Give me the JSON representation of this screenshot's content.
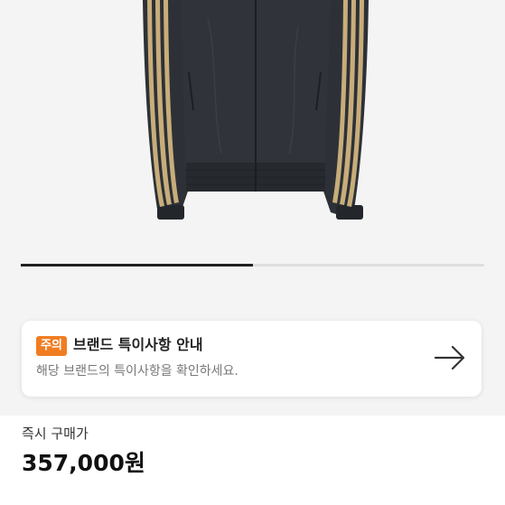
{
  "product": {
    "image_alt": "black track jacket with gold stripes",
    "carousel_progress": 0.5
  },
  "notice": {
    "badge": "주의",
    "title": "브랜드 특이사항 안내",
    "description": "해당 브랜드의 특이사항을 확인하세요.",
    "arrow_icon": "arrow-right-icon",
    "badge_color": "#f07d22"
  },
  "price": {
    "label": "즉시 구매가",
    "value": "357,000원"
  }
}
